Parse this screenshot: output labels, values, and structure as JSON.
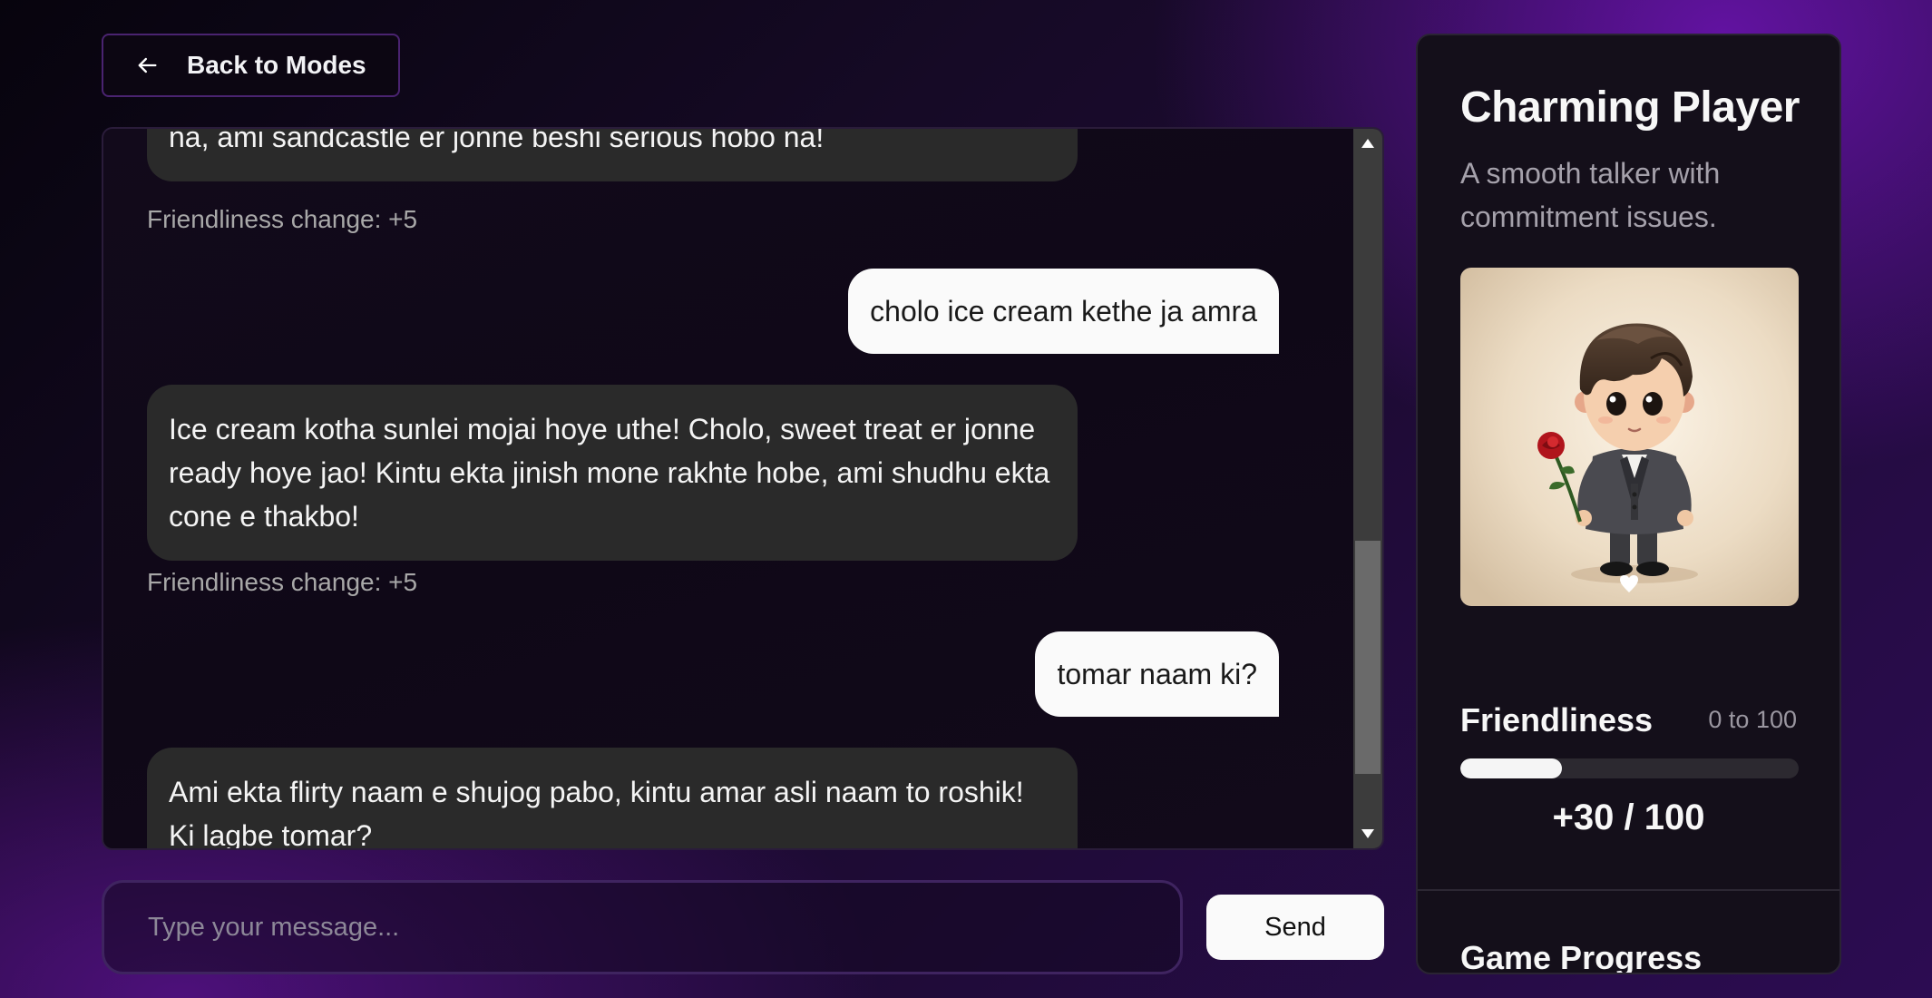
{
  "back_button": {
    "label": "Back to Modes",
    "icon": "arrow-left-icon"
  },
  "chat": {
    "messages": [
      {
        "role": "bot",
        "text": "na, ami sandcastle er jonne beshi serious hobo na!",
        "friendliness_note": "Friendliness change: +5"
      },
      {
        "role": "user",
        "text": "cholo ice cream kethe ja amra"
      },
      {
        "role": "bot",
        "text": "Ice cream kotha sunlei mojai hoye uthe! Cholo, sweet treat er jonne ready hoye jao! Kintu ekta jinish mone rakhte hobe, ami shudhu ekta cone e thakbo!",
        "friendliness_note": "Friendliness change: +5"
      },
      {
        "role": "user",
        "text": "tomar naam ki?"
      },
      {
        "role": "bot",
        "text": "Ami ekta flirty naam e shujog pabo, kintu amar asli naam to roshik! Ki lagbe tomar?"
      }
    ]
  },
  "composer": {
    "placeholder": "Type your message...",
    "send_label": "Send"
  },
  "character": {
    "name": "Charming Player",
    "description": "A smooth talker with commitment issues.",
    "avatar_icon": "charming-player-avatar"
  },
  "friendliness": {
    "label": "Friendliness",
    "range_text": "0 to 100",
    "value": 30,
    "max": 100,
    "score_text": "+30 / 100"
  },
  "game_progress": {
    "title": "Game Progress"
  },
  "colors": {
    "bot_bubble": "#2a2a2a",
    "user_bubble": "#fafafa",
    "panel_bg": "#140f1a",
    "accent_purple": "#4a2370"
  }
}
